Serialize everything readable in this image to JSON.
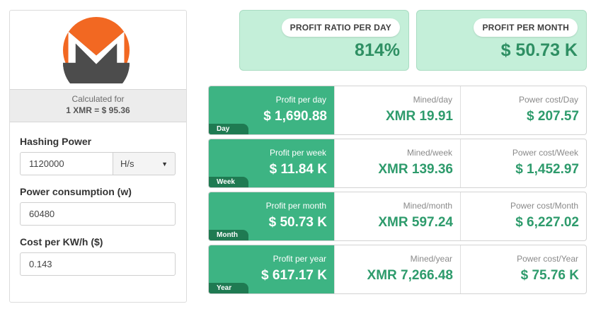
{
  "logo": {
    "icon": "monero-logo",
    "colors": {
      "orange": "#f26822",
      "gray": "#4c4c4c"
    }
  },
  "price": {
    "calculated_for": "Calculated for",
    "rate": "1 XMR = $ 95.36"
  },
  "form": {
    "hashing_power": {
      "label": "Hashing Power",
      "value": "1120000",
      "unit": "H/s"
    },
    "power_consumption": {
      "label": "Power consumption (w)",
      "value": "60480"
    },
    "cost_per_kwh": {
      "label": "Cost per KW/h ($)",
      "value": "0.143"
    }
  },
  "summary": {
    "ratio": {
      "label": "PROFIT RATIO PER DAY",
      "value": "814%"
    },
    "month": {
      "label": "PROFIT PER MONTH",
      "value": "$ 50.73 K"
    }
  },
  "rows": [
    {
      "tag": "Day",
      "profit_label": "Profit per day",
      "profit": "$ 1,690.88",
      "mined_label": "Mined/day",
      "mined": "XMR 19.91",
      "power_label": "Power cost/Day",
      "power": "$ 207.57"
    },
    {
      "tag": "Week",
      "profit_label": "Profit per week",
      "profit": "$ 11.84 K",
      "mined_label": "Mined/week",
      "mined": "XMR 139.36",
      "power_label": "Power cost/Week",
      "power": "$ 1,452.97"
    },
    {
      "tag": "Month",
      "profit_label": "Profit per month",
      "profit": "$ 50.73 K",
      "mined_label": "Mined/month",
      "mined": "XMR 597.24",
      "power_label": "Power cost/Month",
      "power": "$ 6,227.02"
    },
    {
      "tag": "Year",
      "profit_label": "Profit per year",
      "profit": "$ 617.17 K",
      "mined_label": "Mined/year",
      "mined": "XMR 7,266.48",
      "power_label": "Power cost/Year",
      "power": "$ 75.76 K"
    }
  ],
  "colors": {
    "accent": "#3db483",
    "accent_dark": "#1f7a52",
    "value_green": "#2e9b6c",
    "summary_bg": "#c4efd9"
  }
}
